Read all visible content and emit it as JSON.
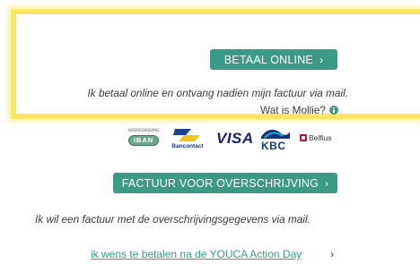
{
  "online": {
    "button_label": "BETAAL ONLINE",
    "button_chevron": "›",
    "description": "Ik betaal online en ontvang nadien mijn factuur via mail.",
    "mollie_link": "Wat is Mollie?",
    "info_icon": "info-icon"
  },
  "payment_logos": {
    "iban_caption": "OVERSCHRIJVING",
    "iban_label": "IBAN",
    "bancontact_label": "Bancontact",
    "visa_label": "VISA",
    "kbc_label": "KBC",
    "belfius_label": "Belfius"
  },
  "transfer": {
    "button_label": "FACTUUR VOOR OVERSCHRIJVING",
    "button_chevron": "›",
    "description": "Ik wil een factuur met de overschrijvingsgegevens via mail."
  },
  "later": {
    "link_text": "ik wens te betalen na de YOUCA Action Day",
    "chevron": "›"
  },
  "colors": {
    "accent": "#3a9a86",
    "highlight_border": "#fce564"
  }
}
